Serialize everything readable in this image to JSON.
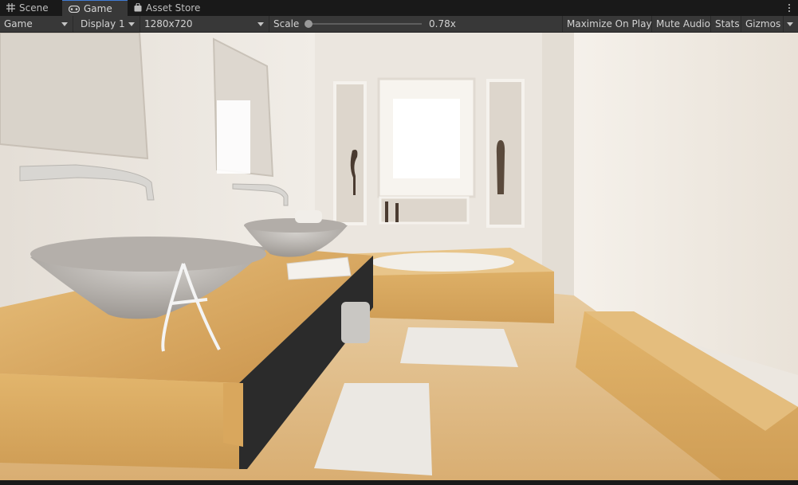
{
  "tabs": [
    {
      "label": "Scene",
      "icon": "grid-icon",
      "active": false
    },
    {
      "label": "Game",
      "icon": "gamepad-icon",
      "active": true
    },
    {
      "label": "Asset Store",
      "icon": "shopping-bag-icon",
      "active": false
    }
  ],
  "toolbar": {
    "view_mode": "Game",
    "display": "Display 1",
    "resolution": "1280x720",
    "scale_label": "Scale",
    "scale_value": "0.78x",
    "scale_fraction": 0.03,
    "maximize_on_play": "Maximize On Play",
    "mute_audio": "Mute Audio",
    "stats": "Stats",
    "gizmos": "Gizmos"
  },
  "colors": {
    "accent": "#3f7bd4",
    "toolbar_bg": "#383838",
    "tabbar_bg": "#191919",
    "wood": "#d8ab62",
    "wall": "#ece7e0"
  }
}
